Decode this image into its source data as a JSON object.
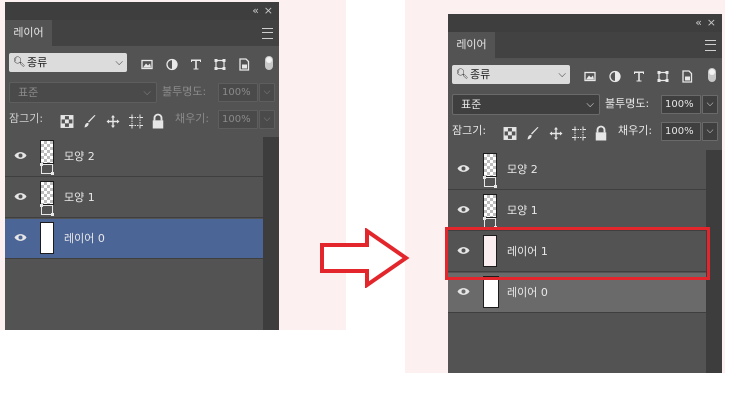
{
  "panel_before": {
    "top_icons": {
      "collapse": "«",
      "close": "×"
    },
    "tab": "레이어",
    "filter": {
      "label": "종류"
    },
    "blend_mode": "표준",
    "opacity_label": "불투명도:",
    "opacity_value": "100%",
    "lock_label": "잠그기:",
    "fill_label": "채우기:",
    "fill_value": "100%",
    "layers": [
      {
        "name": "모양 2",
        "kind": "shape",
        "selected": false
      },
      {
        "name": "모양 1",
        "kind": "shape",
        "selected": false
      },
      {
        "name": "레이어 0",
        "kind": "pixel",
        "selected": true
      }
    ]
  },
  "panel_after": {
    "top_icons": {
      "collapse": "«",
      "close": "×"
    },
    "tab": "레이어",
    "filter": {
      "label": "종류"
    },
    "blend_mode": "표준",
    "opacity_label": "불투명도:",
    "opacity_value": "100%",
    "lock_label": "잠그기:",
    "fill_label": "채우기:",
    "fill_value": "100%",
    "layers": [
      {
        "name": "모양 2",
        "kind": "shape",
        "selected": false
      },
      {
        "name": "모양 1",
        "kind": "shape",
        "selected": false
      },
      {
        "name": "레이어 1",
        "kind": "pixel",
        "selected": true,
        "highlighted": true
      },
      {
        "name": "레이어 0",
        "kind": "pixel",
        "selected": false
      }
    ]
  },
  "icons": {
    "filter_type_icons": [
      "image-filter-icon",
      "adjustment-filter-icon",
      "type-filter-icon",
      "shape-filter-icon",
      "smartobject-filter-icon"
    ],
    "lock_icons": [
      "lock-transparent-icon",
      "lock-paint-icon",
      "lock-move-icon",
      "lock-artboard-icon",
      "lock-all-icon"
    ]
  },
  "colors": {
    "panel_bg": "#535353",
    "selected_row": "#4b6597",
    "highlight_border": "#e2262b",
    "arrow": "#e2262b"
  }
}
